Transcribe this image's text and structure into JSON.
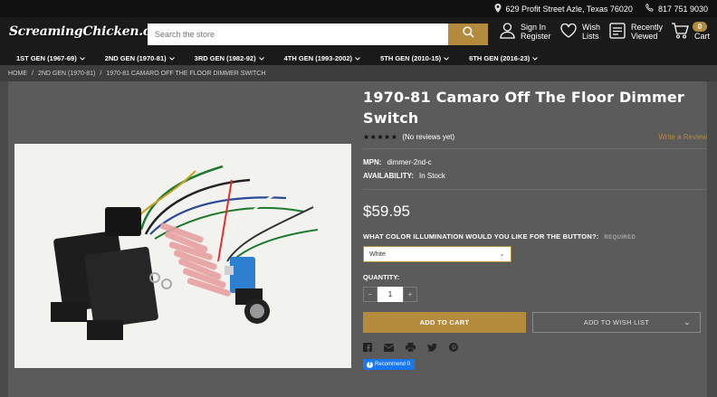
{
  "topbar": {
    "address": "629 Profit Street Azle, Texas 76020",
    "phone": "817 751 9030"
  },
  "header": {
    "logo_text": "ScreamingChicken.com",
    "search_placeholder": "Search the store",
    "signin_line1": "Sign In",
    "signin_line2": "Register",
    "wish_line1": "Wish",
    "wish_line2": "Lists",
    "recent_line1": "Recently",
    "recent_line2": "Viewed",
    "cart_label": "Cart",
    "cart_count": "0"
  },
  "nav": {
    "items": [
      {
        "label": "1ST GEN (1967-69)"
      },
      {
        "label": "2ND GEN (1970-81)"
      },
      {
        "label": "3RD GEN (1982-92)"
      },
      {
        "label": "4TH GEN (1993-2002)"
      },
      {
        "label": "5TH GEN (2010-15)"
      },
      {
        "label": "6TH GEN (2016-23)"
      }
    ]
  },
  "breadcrumb": {
    "items": [
      "HOME",
      "2ND GEN (1970-81)",
      "1970-81 CAMARO OFF THE FLOOR DIMMER SWITCH"
    ],
    "separator": "/"
  },
  "product": {
    "title": "1970-81 Camaro Off The Floor Dimmer Switch",
    "stars": "★★★★★",
    "reviews": "(No reviews yet)",
    "write_review": "Write a Review",
    "mpn_label": "MPN:",
    "mpn_value": "dimmer-2nd-c",
    "availability_label": "AVAILABILITY:",
    "availability_value": "In Stock",
    "price": "$59.95",
    "option_label": "WHAT COLOR ILLUMINATION WOULD YOU LIKE FOR THE BUTTON?:",
    "option_required": "REQUIRED",
    "option_selected": "White",
    "quantity_label": "QUANTITY:",
    "quantity_value": "1",
    "qty_minus": "−",
    "qty_plus": "+",
    "add_to_cart": "ADD TO CART",
    "add_to_wishlist": "ADD TO WISH LIST",
    "fb_recommend": "Recommend 0"
  },
  "colors": {
    "accent": "#b48b3c",
    "background": "#4a4a4a",
    "card": "#5b5b5b",
    "facebook": "#1877f2"
  },
  "icons": [
    "location-icon",
    "phone-icon",
    "search-icon",
    "user-icon",
    "heart-icon",
    "recent-icon",
    "cart-icon",
    "chevron-down-icon",
    "facebook-icon",
    "email-icon",
    "print-icon",
    "twitter-icon",
    "pinterest-icon"
  ]
}
